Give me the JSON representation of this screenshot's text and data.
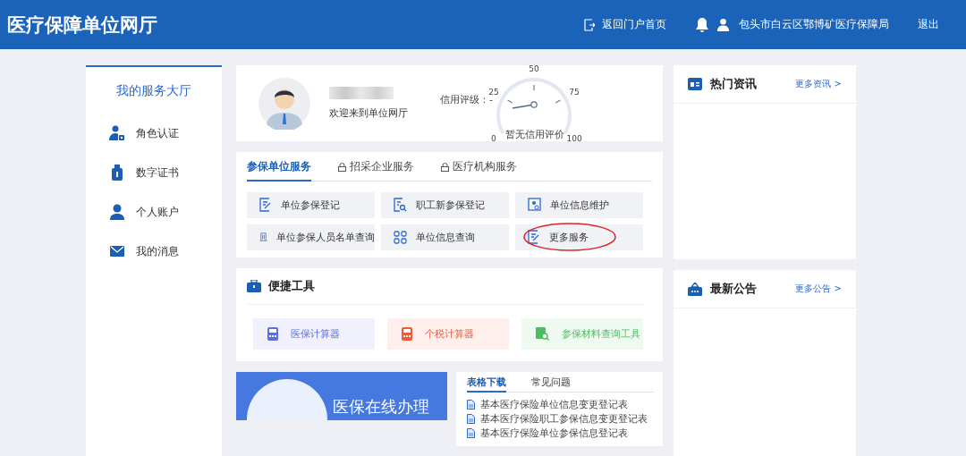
{
  "header": {
    "title": "医疗保障单位网厅",
    "home_link": "返回门户首页",
    "user": "包头市白云区鄂博矿医疗保障局",
    "logout": "退出"
  },
  "sidebar": {
    "title": "我的服务大厅",
    "items": [
      {
        "kind": "role",
        "label": "角色认证"
      },
      {
        "kind": "cert",
        "label": "数字证书"
      },
      {
        "kind": "account",
        "label": "个人账户"
      },
      {
        "kind": "message",
        "label": "我的消息"
      }
    ]
  },
  "profile": {
    "welcome": "欢迎来到单位网厅",
    "credit_label": "信用评级：-",
    "gauge": {
      "ticks": [
        "0",
        "25",
        "50",
        "75",
        "100"
      ],
      "caption": "暂无信用评价"
    }
  },
  "service_tabs": [
    {
      "label": "参保单位服务",
      "selected": true,
      "locked": false
    },
    {
      "label": "招采企业服务",
      "selected": false,
      "locked": true
    },
    {
      "label": "医疗机构服务",
      "selected": false,
      "locked": true
    }
  ],
  "services": [
    {
      "kind": "edit",
      "label": "单位参保登记",
      "circled": false
    },
    {
      "kind": "search-doc",
      "label": "职工新参保登记",
      "circled": false
    },
    {
      "kind": "info",
      "label": "单位信息维护",
      "circled": false
    },
    {
      "kind": "building",
      "label": "单位参保人员名单查询",
      "circled": false
    },
    {
      "kind": "grid",
      "label": "单位信息查询",
      "circled": false
    },
    {
      "kind": "edit",
      "label": "更多服务",
      "circled": true
    }
  ],
  "tools": {
    "title": "便捷工具",
    "items": [
      {
        "kind": "calc",
        "label": "医保计算器",
        "color": "#5b6fe0"
      },
      {
        "kind": "calc",
        "label": "个税计算器",
        "color": "#f0583c"
      },
      {
        "kind": "search",
        "label": "参保材料查询工具",
        "color": "#4cbd63"
      }
    ]
  },
  "banner": {
    "text": "医保在线办理"
  },
  "downloads": {
    "tabs": [
      {
        "label": "表格下载",
        "selected": true
      },
      {
        "label": "常见问题",
        "selected": false
      }
    ],
    "items": [
      "基本医疗保险单位信息变更登记表",
      "基本医疗保险职工参保信息变更登记表",
      "基本医疗保险单位参保信息登记表"
    ]
  },
  "news": {
    "title": "热门资讯",
    "more": "更多资讯 >"
  },
  "notices": {
    "title": "最新公告",
    "more": "更多公告 >"
  }
}
